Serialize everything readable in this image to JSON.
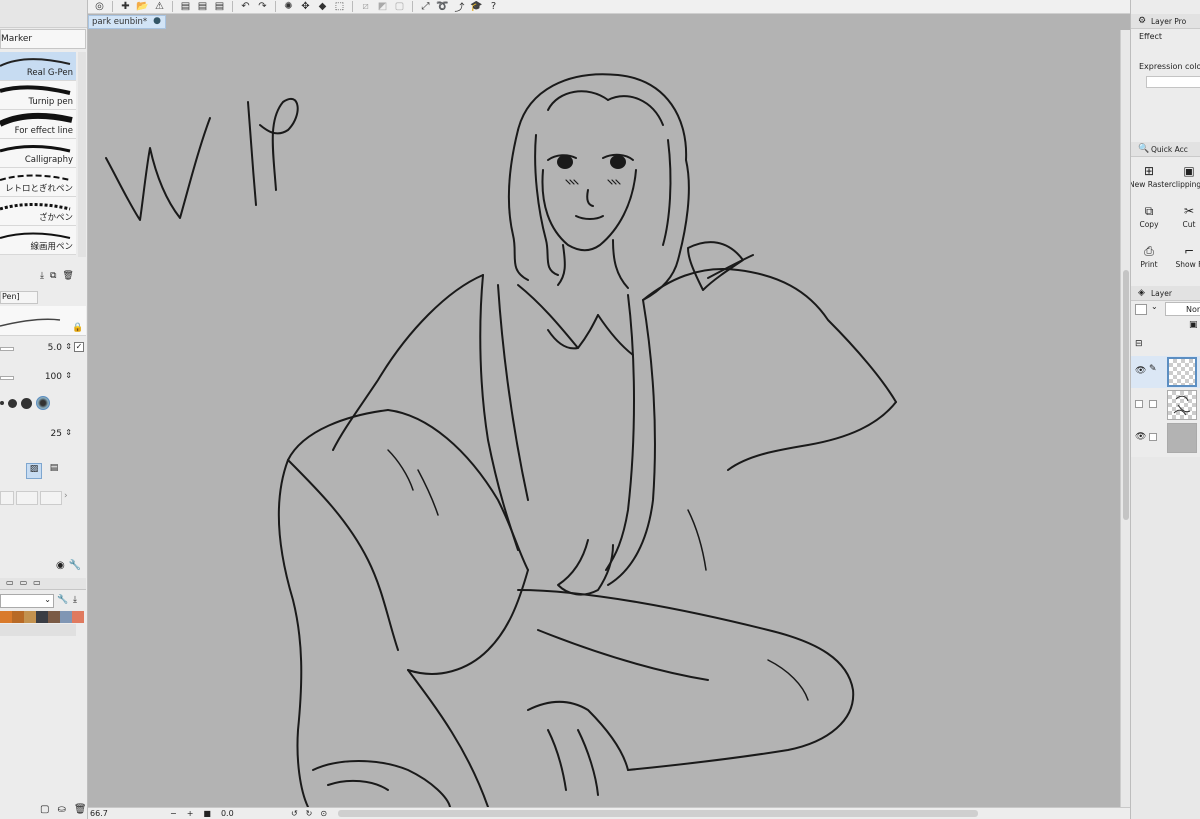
{
  "document": {
    "tab_title": "park eunbin*",
    "modified_marker": "●"
  },
  "brush_panel": {
    "header": "Marker",
    "brushes": [
      {
        "name": "Real G-Pen",
        "selected": true
      },
      {
        "name": "Turnip pen",
        "selected": false
      },
      {
        "name": "For effect line",
        "selected": false
      },
      {
        "name": "Calligraphy",
        "selected": false
      },
      {
        "name": "レトロとぎれペン",
        "selected": false
      },
      {
        "name": "ざかペン",
        "selected": false
      },
      {
        "name": "線画用ペン",
        "selected": false
      }
    ]
  },
  "tool_property": {
    "tab_label": "Pen]",
    "brush_size": "5.0",
    "opacity": "100",
    "stabilization": "25"
  },
  "palette": {
    "swatches": [
      "#d97a2b",
      "#b86a26",
      "#c3924f",
      "#3a3d44",
      "#7a5a45",
      "#8096b4",
      "#e07a5f"
    ]
  },
  "canvas": {
    "wip_text": "WIP",
    "background": "#b3b3b3"
  },
  "status": {
    "zoom": "66.7",
    "rotation": "0.0"
  },
  "right_panel": {
    "layer_property_title": "Layer Pro",
    "effect_label": "Effect",
    "expression_color_label": "Expression colo",
    "quick_access_title": "Quick Acc",
    "quick_items": [
      {
        "label": "New Raster",
        "icon": "new-raster-icon"
      },
      {
        "label": "clipping f",
        "icon": "clipping-icon"
      },
      {
        "label": "Copy",
        "icon": "copy-icon"
      },
      {
        "label": "Cut",
        "icon": "cut-icon"
      },
      {
        "label": "Print",
        "icon": "print-icon"
      },
      {
        "label": "Show F",
        "icon": "show-frame-icon"
      }
    ],
    "layer_title": "Layer",
    "blend_mode": "Non"
  }
}
